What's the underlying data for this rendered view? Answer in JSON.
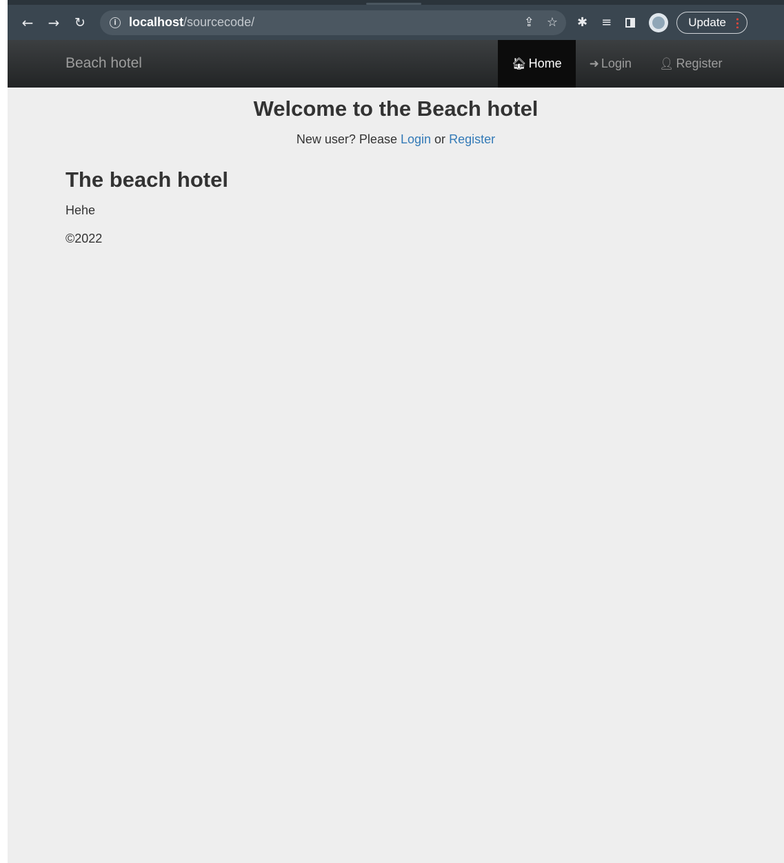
{
  "browser": {
    "url_host": "localhost",
    "url_path": "/sourcecode/",
    "update_label": "Update",
    "icons": [
      "back-arrow-icon",
      "forward-arrow-icon",
      "reload-icon",
      "info-icon",
      "share-icon",
      "star-icon",
      "extensions-icon",
      "media-queue-icon",
      "side-panel-icon",
      "profile-avatar",
      "kebab-menu-icon"
    ]
  },
  "navbar": {
    "brand": "Beach hotel",
    "items": [
      {
        "label": "Home",
        "icon": "home-icon",
        "active": true
      },
      {
        "label": "Login",
        "icon": "login-icon",
        "active": false
      },
      {
        "label": "Register",
        "icon": "user-icon",
        "active": false
      }
    ]
  },
  "main": {
    "heading": "Welcome to the Beach hotel",
    "lead_prefix": "New user? Please",
    "lead_login": "Login",
    "lead_or": "or",
    "lead_register": "Register",
    "section_title": "The beach hotel",
    "paragraph": "Hehe",
    "copyright": "©2022"
  },
  "colors": {
    "link": "#337ab7",
    "navbar_bg": "#222222",
    "content_bg": "#eeeeee"
  }
}
